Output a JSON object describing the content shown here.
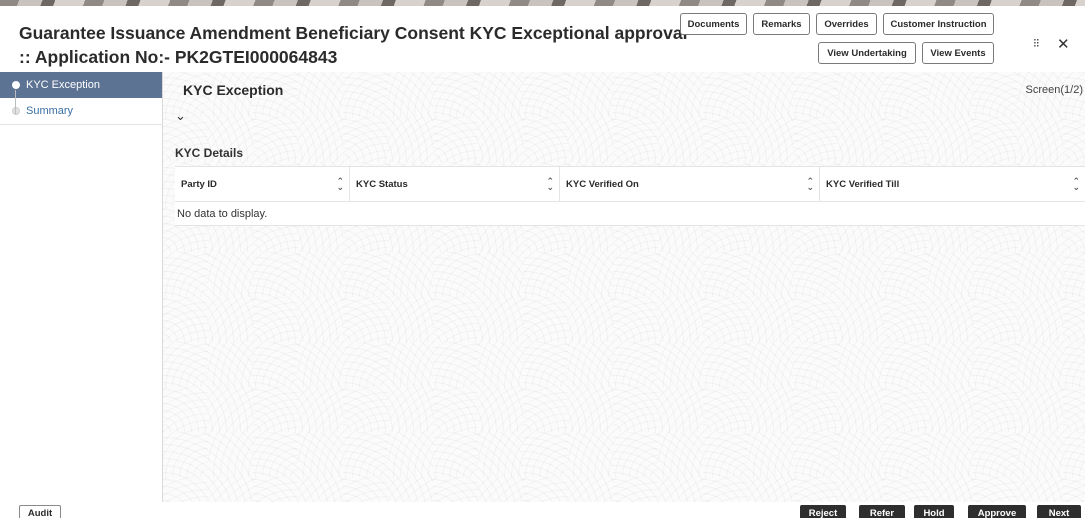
{
  "header": {
    "title_line1": "Guarantee Issuance Amendment Beneficiary Consent KYC Exceptional approval",
    "title_line2": ":: Application No:- PK2GTEI000064843",
    "buttons": {
      "documents": "Documents",
      "remarks": "Remarks",
      "overrides": "Overrides",
      "customer_instruction": "Customer Instruction",
      "view_undertaking": "View Undertaking",
      "view_events": "View Events"
    },
    "controls": {
      "minimize_icon": "⁝⁝",
      "close_icon": "✕"
    }
  },
  "sidebar": {
    "items": [
      {
        "label": "KYC Exception",
        "active": true
      },
      {
        "label": "Summary",
        "active": false
      }
    ]
  },
  "main": {
    "section_title": "KYC Exception",
    "screen_indicator": "Screen(1/2)",
    "chevron": "⌄",
    "subsection_title": "KYC Details",
    "table": {
      "columns": [
        "Party ID",
        "KYC Status",
        "KYC Verified On",
        "KYC Verified Till"
      ],
      "sort_icon": "⌃⌄",
      "empty_message": "No data to display."
    }
  },
  "footer": {
    "audit": "Audit",
    "reject": "Reject",
    "refer": "Refer",
    "hold": "Hold",
    "approve": "Approve",
    "next": "Next"
  },
  "colors": {
    "sidebar_active_bg": "#5d7394",
    "sidebar_inactive_text": "#3b6fa3",
    "footer_button_bg": "#2e2e2e"
  }
}
